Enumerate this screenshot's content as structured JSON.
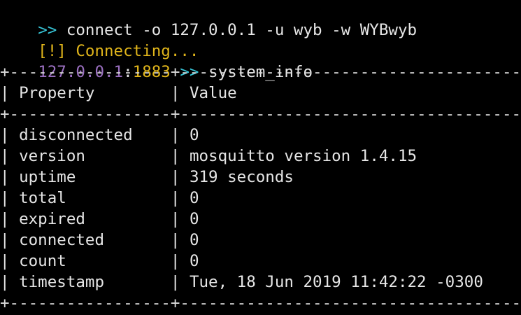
{
  "colors": {
    "background": "#000000",
    "prompt": "#37c6d8",
    "warning": "#e0b51b",
    "ip": "#9a6fc0",
    "port": "#e0b51b",
    "text": "#e6e6e6"
  },
  "session": {
    "prompt_symbol": ">>",
    "command": "connect -o 127.0.0.1 -u wyb -w WYBwyb",
    "status_tag": "[!]",
    "status_text": "Connecting...",
    "host": "127.0.0.1",
    "host_sep": ":",
    "port": "1883",
    "prompt2_symbol": ">>",
    "command2": "system_info"
  },
  "table": {
    "border_line": "+-----------------+-------------------------------------+",
    "header": {
      "property": "Property",
      "value": "Value"
    },
    "rows": [
      {
        "property": "disconnected",
        "value": "0"
      },
      {
        "property": "version",
        "value": "mosquitto version 1.4.15"
      },
      {
        "property": "uptime",
        "value": "319 seconds"
      },
      {
        "property": "total",
        "value": "0"
      },
      {
        "property": "expired",
        "value": "0"
      },
      {
        "property": "connected",
        "value": "0"
      },
      {
        "property": "count",
        "value": "0"
      },
      {
        "property": "timestamp",
        "value": "Tue, 18 Jun 2019 11:42:22 -0300"
      }
    ]
  }
}
